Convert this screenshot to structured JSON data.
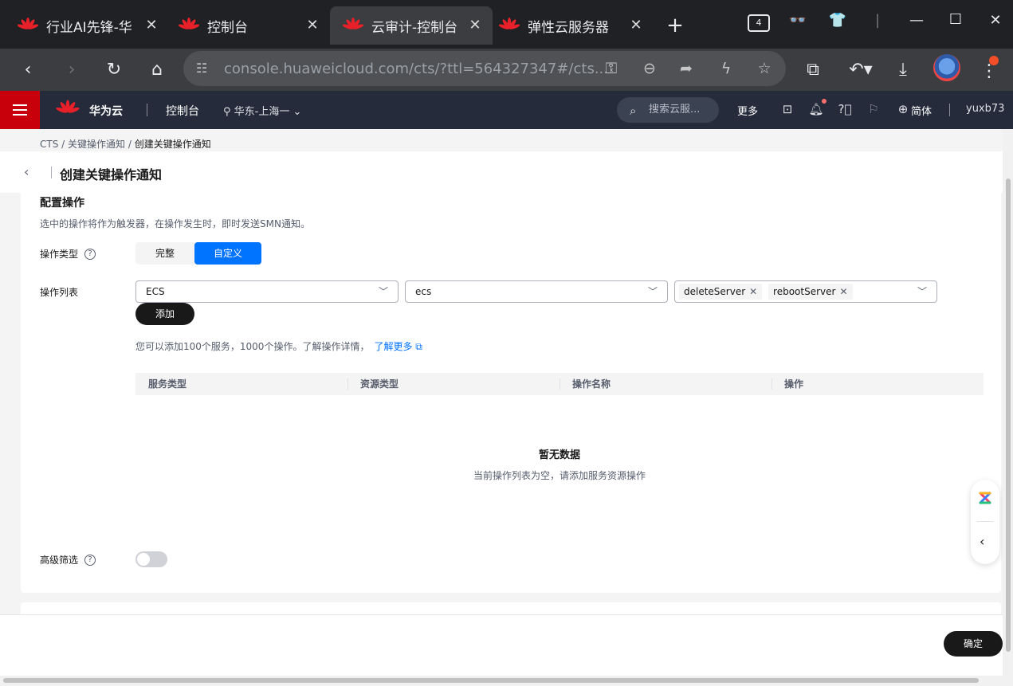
{
  "browser": {
    "tabs": [
      {
        "title": "行业AI先锋-华",
        "active": false
      },
      {
        "title": "控制台",
        "active": false
      },
      {
        "title": "云审计-控制台",
        "active": true
      },
      {
        "title": "弹性云服务器",
        "active": false
      }
    ],
    "tab_count": "4",
    "url": "console.huaweicloud.com/cts/?ttl=564327347#/cts..."
  },
  "header": {
    "brand": "华为云",
    "console": "控制台",
    "region": "华东-上海一",
    "search_placeholder": "搜索云服...",
    "more": "更多",
    "language": "简体",
    "user": "yuxb73"
  },
  "breadcrumb": {
    "items": [
      "CTS",
      "关键操作通知",
      "创建关键操作通知"
    ],
    "separator": "/"
  },
  "page_title": "创建关键操作通知",
  "config": {
    "section_title": "配置操作",
    "section_desc": "选中的操作将作为触发器，在操作发生时，即时发送SMN通知。",
    "op_type_label": "操作类型",
    "op_type_options": [
      "完整",
      "自定义"
    ],
    "op_type_selected": "自定义",
    "op_list_label": "操作列表",
    "service_select": "ECS",
    "resource_select": "ecs",
    "operation_tags": [
      "deleteServer",
      "rebootServer"
    ],
    "add_button": "添加",
    "hint": "您可以添加100个服务，1000个操作。了解操作详情，",
    "learn_more": "了解更多",
    "table_columns": [
      "服务类型",
      "资源类型",
      "操作名称",
      "操作"
    ],
    "empty_title": "暂无数据",
    "empty_desc": "当前操作列表为空，请添加服务资源操作",
    "advanced_filter_label": "高级筛选",
    "advanced_filter_on": false
  },
  "footer": {
    "confirm": "确定"
  },
  "colors": {
    "brand_red": "#c7000b",
    "primary_blue": "#0073ff",
    "header_bg": "#252b3a",
    "dark_button": "#191919"
  }
}
